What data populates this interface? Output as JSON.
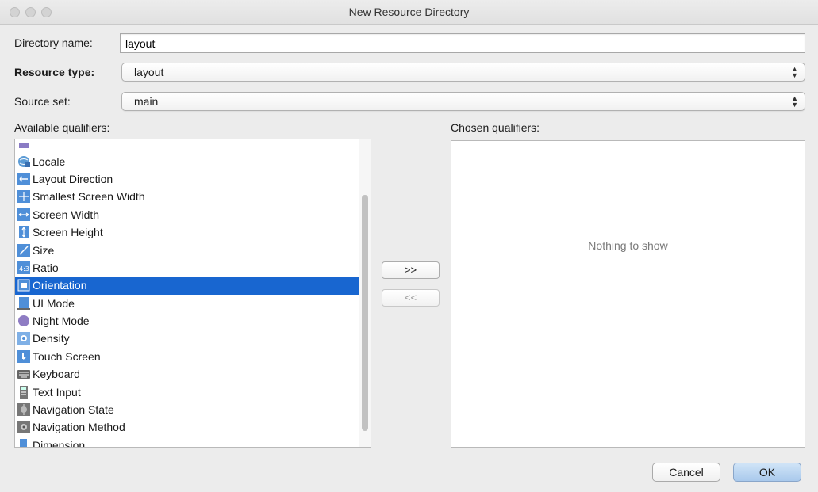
{
  "window": {
    "title": "New Resource Directory"
  },
  "form": {
    "directory_name_label": "Directory name:",
    "directory_name_value": "layout",
    "resource_type_label": "Resource type:",
    "resource_type_value": "layout",
    "source_set_label": "Source set:",
    "source_set_value": "main"
  },
  "available": {
    "label": "Available qualifiers:",
    "items": [
      {
        "label": "Locale",
        "icon": "globe-icon",
        "selected": false
      },
      {
        "label": "Layout Direction",
        "icon": "layout-direction-icon",
        "selected": false
      },
      {
        "label": "Smallest Screen Width",
        "icon": "smallest-width-icon",
        "selected": false
      },
      {
        "label": "Screen Width",
        "icon": "screen-width-icon",
        "selected": false
      },
      {
        "label": "Screen Height",
        "icon": "screen-height-icon",
        "selected": false
      },
      {
        "label": "Size",
        "icon": "size-icon",
        "selected": false
      },
      {
        "label": "Ratio",
        "icon": "ratio-icon",
        "selected": false
      },
      {
        "label": "Orientation",
        "icon": "orientation-icon",
        "selected": true
      },
      {
        "label": "UI Mode",
        "icon": "ui-mode-icon",
        "selected": false
      },
      {
        "label": "Night Mode",
        "icon": "night-mode-icon",
        "selected": false
      },
      {
        "label": "Density",
        "icon": "density-icon",
        "selected": false
      },
      {
        "label": "Touch Screen",
        "icon": "touch-screen-icon",
        "selected": false
      },
      {
        "label": "Keyboard",
        "icon": "keyboard-icon",
        "selected": false
      },
      {
        "label": "Text Input",
        "icon": "text-input-icon",
        "selected": false
      },
      {
        "label": "Navigation State",
        "icon": "navigation-state-icon",
        "selected": false
      },
      {
        "label": "Navigation Method",
        "icon": "navigation-method-icon",
        "selected": false
      },
      {
        "label": "Dimension",
        "icon": "dimension-icon",
        "selected": false
      }
    ]
  },
  "chosen": {
    "label": "Chosen qualifiers:",
    "empty_text": "Nothing to show"
  },
  "transfer": {
    "add_label": ">>",
    "remove_label": "<<"
  },
  "buttons": {
    "cancel_label": "Cancel",
    "ok_label": "OK"
  },
  "colors": {
    "selection": "#1866d0",
    "background": "#ececec"
  }
}
